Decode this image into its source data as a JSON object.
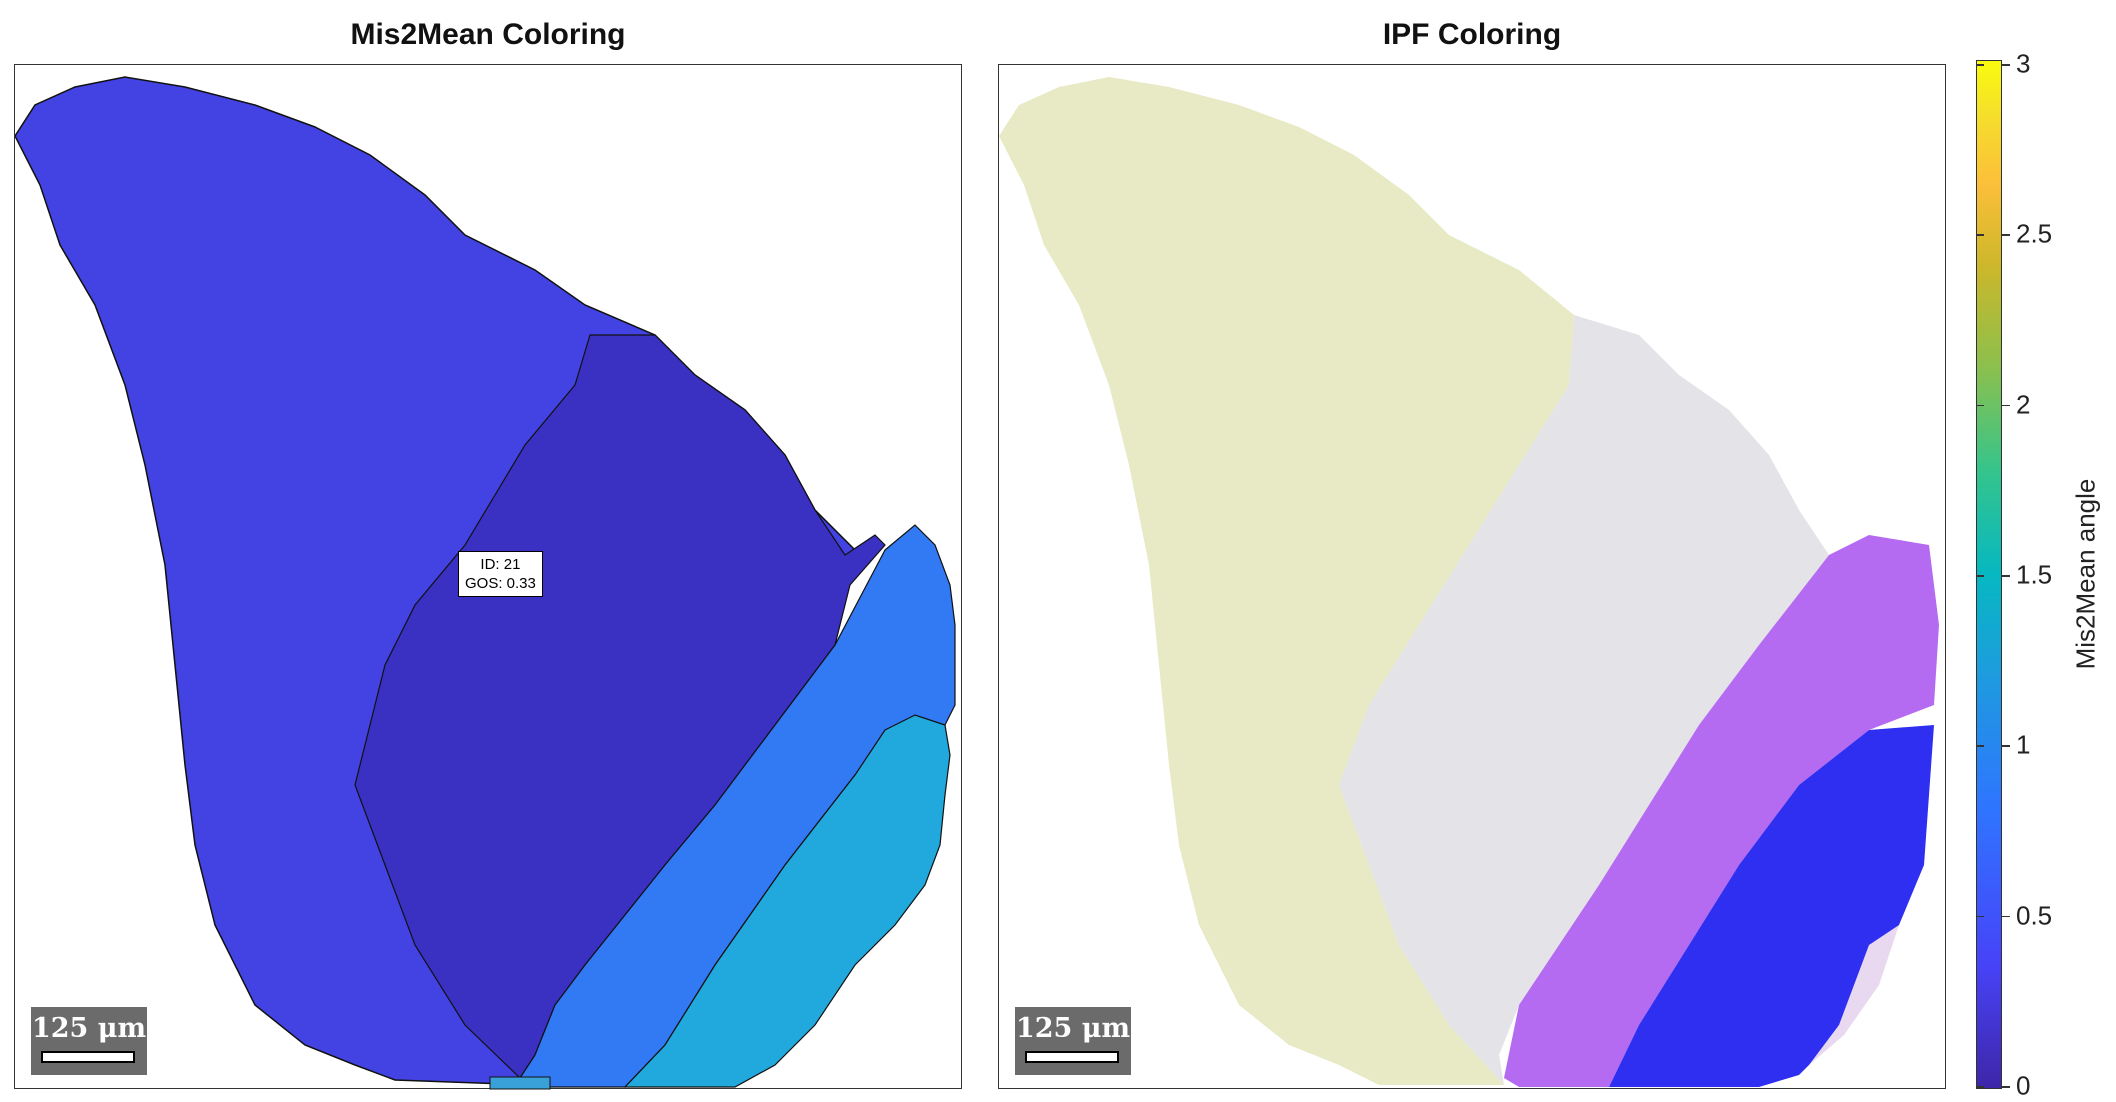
{
  "panels": {
    "left": {
      "title": "Mis2Mean Coloring",
      "grain_label": {
        "id_text": "ID: 21",
        "gos_text": "GOS: 0.33"
      },
      "scalebar_text": "125 μm"
    },
    "right": {
      "title": "IPF Coloring",
      "scalebar_text": "125 μm"
    }
  },
  "colorbar": {
    "label": "Mis2Mean angle",
    "ticks": [
      "0",
      "0.5",
      "1",
      "1.5",
      "2",
      "2.5",
      "3"
    ],
    "range": [
      0,
      3
    ],
    "colormap": "parula"
  },
  "colors": {
    "grain_main": "#4242e6",
    "grain_dark": "#3c2fc4",
    "grain_blue": "#3479f6",
    "grain_cyan": "#1ea6db",
    "ipf_yellow": "#e8ebc4",
    "ipf_white": "#e4e4e8",
    "ipf_purple": "#b46af2",
    "ipf_blue": "#2f2cf0"
  }
}
